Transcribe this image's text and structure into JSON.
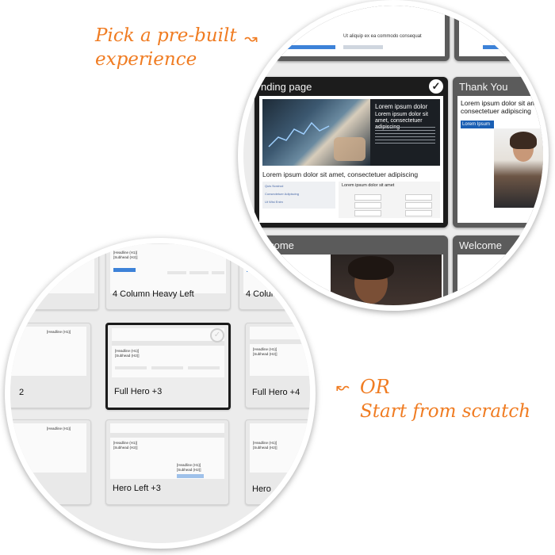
{
  "captions": {
    "prebuilt": "Pick a pre-built experience",
    "scratch": "Start from scratch",
    "or": "OR"
  },
  "icons": {
    "arrow": "curved-arrow-icon",
    "check": "checkmark-icon"
  },
  "colors": {
    "accent": "#f07c22",
    "button_blue": "#3d82d8",
    "selected_border": "#1c1c1c"
  },
  "templates": {
    "top_left_text": "Ut aliquip ex ea commodo consequat",
    "landing_page": {
      "title": "nding page",
      "hero_heading": "Lorem ipsum dolor",
      "hero_sub": "Lorem ipsum dolor sit amet, consectetuer adipiscing",
      "headline": "Lorem ipsum dolor sit amet, consectetuer adipiscing",
      "list": [
        "Quis Nostrud",
        "Consectetuer Adipiscing",
        "Ut Wisi Enim"
      ],
      "form_heading": "Lorem ipsum dolor sit amet",
      "selected": true
    },
    "thank_you": {
      "title": "Thank You",
      "heading": "Lorem ipsum dolor sit amet, consectetuer adipiscing",
      "bar": "Lorem Ipsum"
    },
    "welcome_left": {
      "title": "elcome"
    },
    "welcome_right": {
      "title": "Welcome"
    }
  },
  "layouts": {
    "headline": "[Headline (H1)]",
    "subhead": "[Subhead (H2)]",
    "button": "[Button Link]",
    "items": [
      {
        "label": "4 Column Heavy Left",
        "selected": false
      },
      {
        "label": "4 Colum",
        "selected": false
      },
      {
        "label": "Full Hero +3",
        "selected": true
      },
      {
        "label": "Full Hero +4",
        "selected": false
      },
      {
        "label": "Hero Left +3",
        "selected": false
      },
      {
        "label": "Hero",
        "selected": false
      },
      {
        "label": "2",
        "selected": false
      }
    ]
  }
}
